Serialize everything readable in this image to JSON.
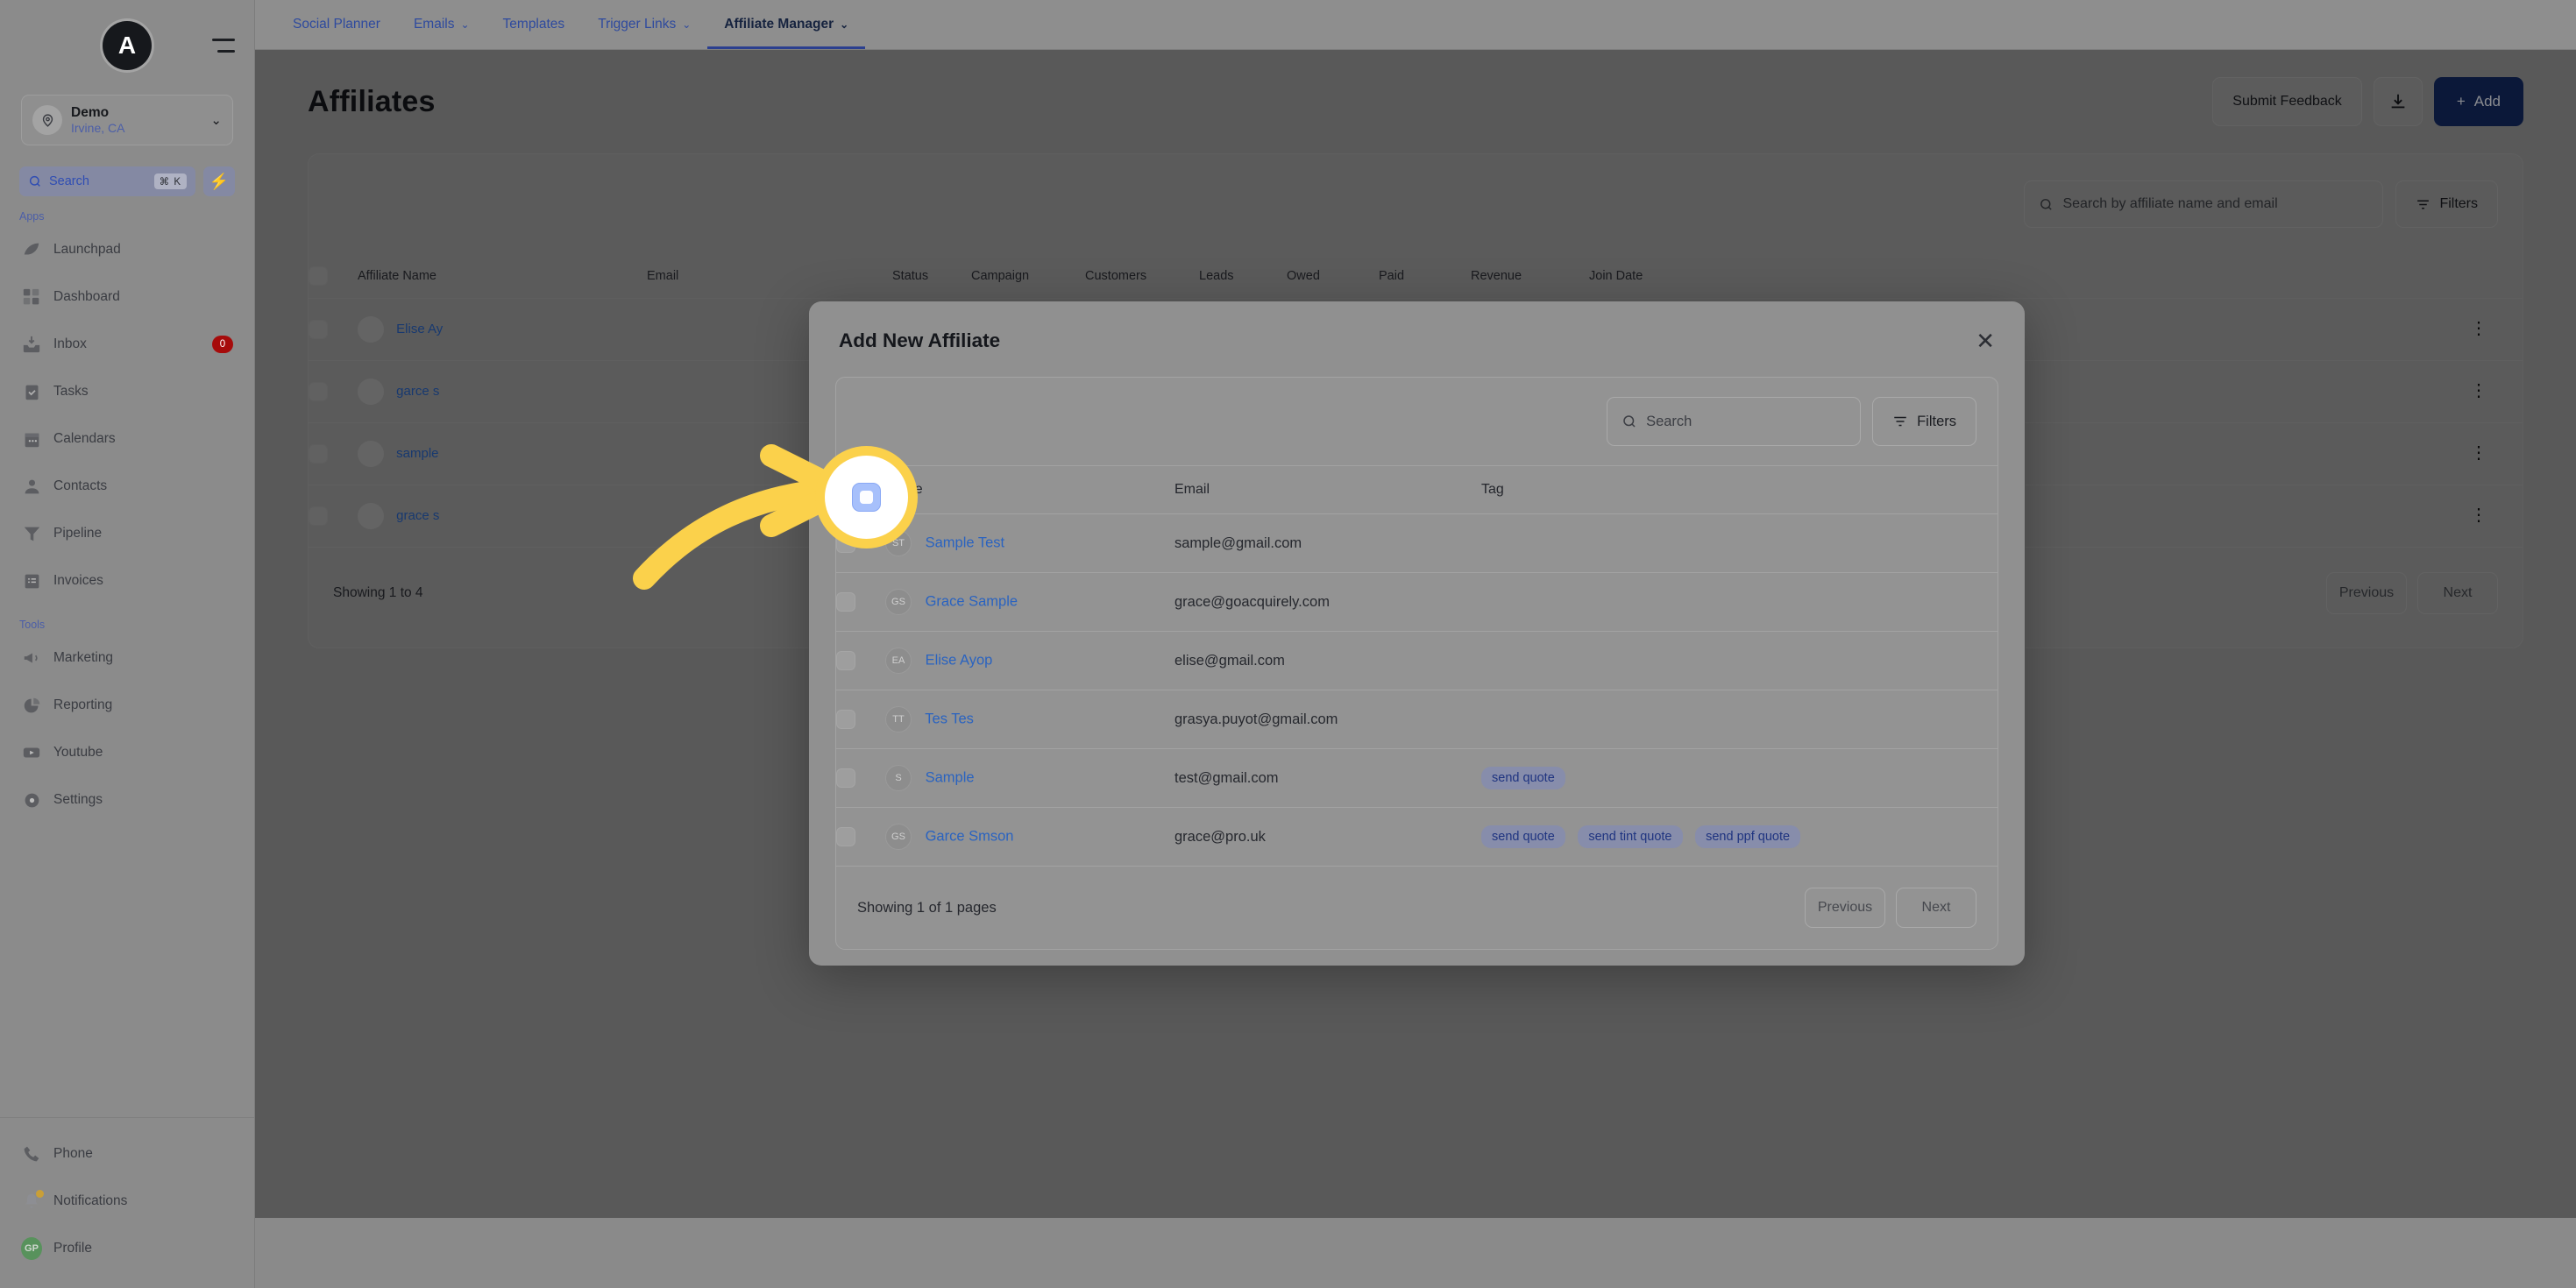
{
  "sidebar": {
    "logo_letter": "A",
    "location": {
      "name": "Demo",
      "sub": "Irvine, CA"
    },
    "search": {
      "label": "Search",
      "shortcut": "⌘ K"
    },
    "sections": [
      {
        "label": "Apps",
        "items": [
          {
            "label": "Launchpad",
            "icon": "launchpad-icon",
            "badge": ""
          },
          {
            "label": "Dashboard",
            "icon": "dashboard-icon",
            "badge": ""
          },
          {
            "label": "Inbox",
            "icon": "inbox-icon",
            "badge": "0"
          },
          {
            "label": "Tasks",
            "icon": "tasks-icon",
            "badge": ""
          },
          {
            "label": "Calendars",
            "icon": "calendar-icon",
            "badge": ""
          },
          {
            "label": "Contacts",
            "icon": "contacts-icon",
            "badge": ""
          },
          {
            "label": "Pipeline",
            "icon": "pipeline-icon",
            "badge": ""
          },
          {
            "label": "Invoices",
            "icon": "invoices-icon",
            "badge": ""
          }
        ]
      },
      {
        "label": "Tools",
        "items": [
          {
            "label": "Marketing",
            "icon": "megaphone-icon",
            "badge": ""
          },
          {
            "label": "Reporting",
            "icon": "pie-chart-icon",
            "badge": ""
          },
          {
            "label": "Youtube",
            "icon": "youtube-icon",
            "badge": ""
          },
          {
            "label": "Settings",
            "icon": "gear-icon",
            "badge": ""
          }
        ]
      }
    ],
    "bottom": [
      {
        "label": "Phone",
        "icon": "phone-icon"
      },
      {
        "label": "Notifications",
        "icon": "bell-icon"
      },
      {
        "label": "Profile",
        "icon": "avatar-icon",
        "initials": "GP"
      }
    ]
  },
  "topnav": {
    "tabs": [
      {
        "label": "Social Planner",
        "caret": false,
        "active": false
      },
      {
        "label": "Emails",
        "caret": true,
        "active": false
      },
      {
        "label": "Templates",
        "caret": false,
        "active": false
      },
      {
        "label": "Trigger Links",
        "caret": true,
        "active": false
      },
      {
        "label": "Affiliate Manager",
        "caret": true,
        "active": true
      }
    ]
  },
  "page": {
    "title": "Affiliates",
    "submit_feedback_label": "Submit Feedback",
    "download_icon": "download-icon",
    "add_label": "Add",
    "search_placeholder": "Search by affiliate name and email",
    "filters_label": "Filters",
    "table": {
      "columns": [
        "Affiliate Name",
        "Email",
        "Status",
        "Campaign",
        "Customers",
        "Leads",
        "Owed",
        "Paid",
        "Revenue",
        "Join Date"
      ],
      "rows": [
        {
          "name": "Elise Ay"
        },
        {
          "name": "garce s"
        },
        {
          "name": "sample"
        },
        {
          "name": "grace s"
        }
      ]
    },
    "footer_text": "Showing 1 to 4",
    "previous_label": "Previous",
    "next_label": "Next"
  },
  "modal": {
    "title": "Add New Affiliate",
    "close_icon": "close-icon",
    "search_placeholder": "Search",
    "filters_label": "Filters",
    "columns": [
      "Name",
      "Email",
      "Tag"
    ],
    "rows": [
      {
        "initials": "ST",
        "name": "Sample Test",
        "email": "sample@gmail.com",
        "tags": []
      },
      {
        "initials": "GS",
        "name": "Grace Sample",
        "email": "grace@goacquirely.com",
        "tags": []
      },
      {
        "initials": "EA",
        "name": "Elise Ayop",
        "email": "elise@gmail.com",
        "tags": []
      },
      {
        "initials": "TT",
        "name": "Tes Tes",
        "email": "grasya.puyot@gmail.com",
        "tags": []
      },
      {
        "initials": "S",
        "name": "Sample",
        "email": "test@gmail.com",
        "tags": [
          "send quote"
        ]
      },
      {
        "initials": "GS",
        "name": "Garce Smson",
        "email": "grace@pro.uk",
        "tags": [
          "send quote",
          "send tint quote",
          "send ppf quote"
        ]
      }
    ],
    "footer_text": "Showing 1 of 1 pages",
    "previous_label": "Previous",
    "next_label": "Next"
  },
  "annotation": {
    "highlight_target": "select-all-checkbox",
    "ring_color": "#FBD14B",
    "arrow_color": "#FBD14B",
    "checkbox_color": "#A7C0FB"
  }
}
